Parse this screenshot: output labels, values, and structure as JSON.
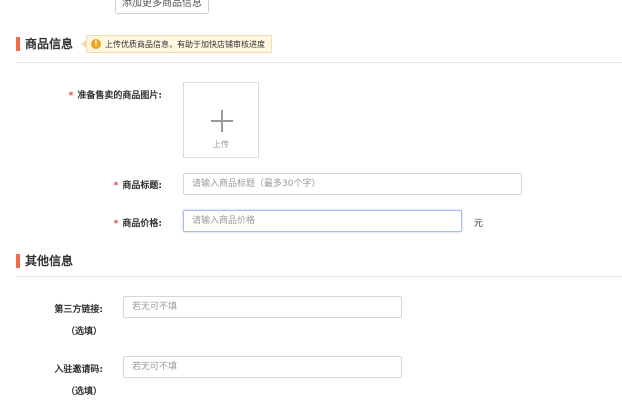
{
  "top_button": {
    "label": "添加更多商品信息"
  },
  "product_section": {
    "title": "商品信息",
    "tip": "上传优质商品信息，有助于加快店铺审核进度",
    "tip_icon": "!",
    "image_field": {
      "required_mark": "*",
      "label": "准备售卖的商品图片:",
      "upload_text": "上传"
    },
    "title_field": {
      "required_mark": "*",
      "label": "商品标题:",
      "placeholder": "请输入商品标题（最多30个字）"
    },
    "price_field": {
      "required_mark": "*",
      "label": "商品价格:",
      "placeholder": "请输入商品价格",
      "unit": "元"
    }
  },
  "other_section": {
    "title": "其他信息",
    "link_field": {
      "label": "第三方链接:",
      "sub": "（选填）",
      "placeholder": "若无可不填"
    },
    "invite_field": {
      "label": "入驻邀请码:",
      "sub": "（选填）",
      "placeholder": "若无可不填"
    }
  },
  "colors": {
    "accent": "#f26a4b",
    "required": "#e4393c",
    "tip_bg": "#fff7e0",
    "tip_icon": "#f0a21b"
  }
}
